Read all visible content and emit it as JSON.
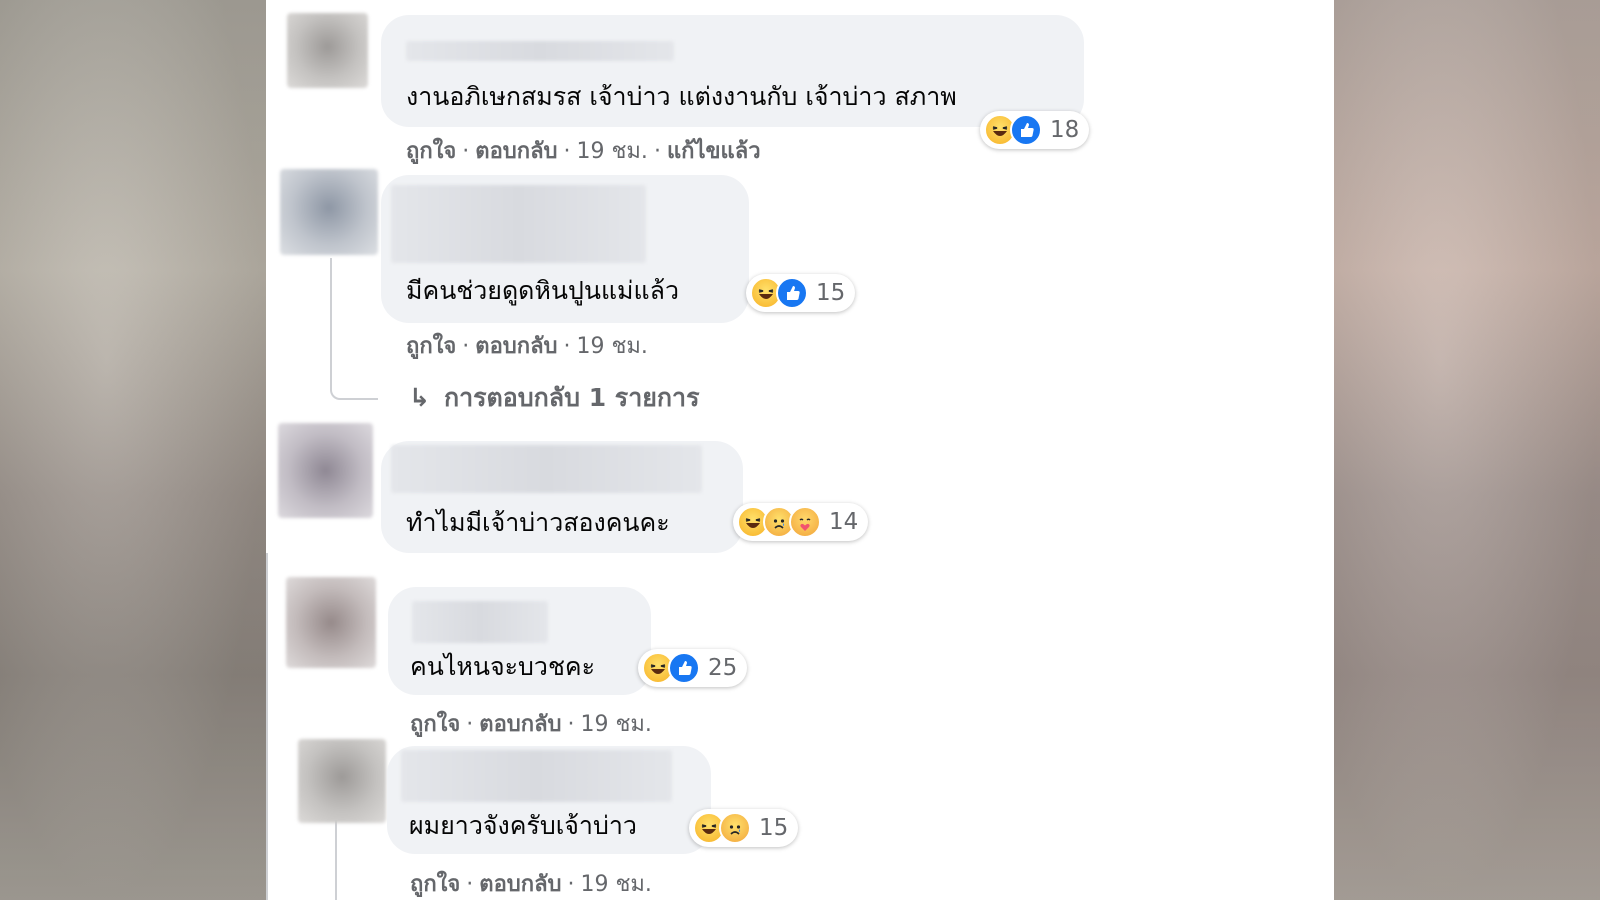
{
  "comments": [
    {
      "text": "งานอภิเษกสมรส เจ้าบ่าว แต่งงานกับ เจ้าบ่าว สภาพ",
      "reaction_count": "18",
      "reactions": [
        "haha-icon",
        "like-icon"
      ],
      "like": "ถูกใจ",
      "reply": "ตอบกลับ",
      "time": "19 ชม.",
      "edited": "แก้ไขแล้ว"
    },
    {
      "text": "มีคนช่วยดูดหินปูนแม่แล้ว",
      "reaction_count": "15",
      "reactions": [
        "haha-icon",
        "like-icon"
      ],
      "like": "ถูกใจ",
      "reply": "ตอบกลับ",
      "time": "19 ชม.",
      "replies_link": "การตอบกลับ 1 รายการ"
    },
    {
      "text": "ทำไมมีเจ้าบ่าวสองคนคะ",
      "reaction_count": "14",
      "reactions": [
        "haha-icon",
        "sad-icon",
        "care-icon"
      ]
    },
    {
      "text": "คนไหนจะบวชคะ",
      "reaction_count": "25",
      "reactions": [
        "haha-icon",
        "like-icon"
      ],
      "like": "ถูกใจ",
      "reply": "ตอบกลับ",
      "time": "19 ชม."
    },
    {
      "text": "ผมยาวจังครับเจ้าบ่าว",
      "reaction_count": "15",
      "reactions": [
        "haha-icon",
        "sad-icon"
      ],
      "like": "ถูกใจ",
      "reply": "ตอบกลับ",
      "time": "19 ชม."
    }
  ],
  "colors": {
    "bubble": "#f0f2f5",
    "meta_text": "#65676b",
    "like_blue": "#1877f2"
  }
}
